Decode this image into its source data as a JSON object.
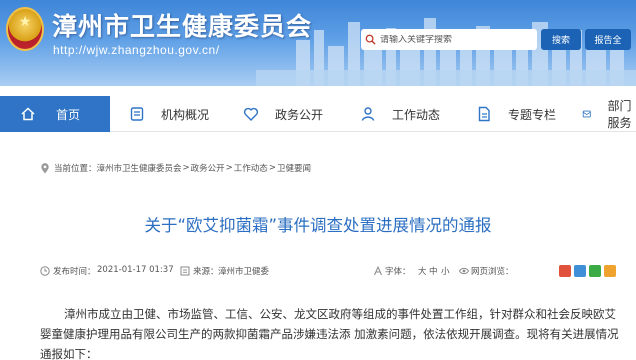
{
  "header": {
    "site_title": "漳州市卫生健康委员会",
    "site_url": "http://wjw.zhangzhou.gov.cn/",
    "search_placeholder": "请输入关键字搜索",
    "search_button": "搜索",
    "advanced_search_button": "报告全"
  },
  "nav": {
    "items": [
      {
        "label": "首页",
        "icon": "home-icon",
        "active": true
      },
      {
        "label": "机构概况",
        "icon": "org-icon",
        "active": false
      },
      {
        "label": "政务公开",
        "icon": "heart-icon",
        "active": false
      },
      {
        "label": "工作动态",
        "icon": "people-icon",
        "active": false
      },
      {
        "label": "专题专栏",
        "icon": "document-icon",
        "active": false
      },
      {
        "label": "部门服务",
        "icon": "service-icon",
        "active": false
      }
    ]
  },
  "breadcrumb": {
    "prefix": "当前位置：",
    "items": [
      "漳州市卫生健康委员会",
      "政务公开",
      "工作动态",
      "卫健要闻"
    ],
    "separator": ">"
  },
  "article": {
    "title": "关于“欧艾抑菌霜”事件调查处置进展情况的通报",
    "meta": {
      "publish_label": "发布时间：",
      "publish_time": "2021-01-17 01:37",
      "source_label": "来源：",
      "source": "漳州市卫健委",
      "font_label": "字体：",
      "font_large": "大",
      "font_medium": "中",
      "font_small": "小",
      "visits_label": "网页浏览："
    },
    "paragraph": "漳州市成立由卫健、市场监管、工信、公安、龙文区政府等组成的事件处置工作组，针对群众和社会反映欧艾婴童健康护理用品有限公司生产的两款抑菌霜产品涉嫌违法添 加激素问题，依法依规开展调查。现将有关进展情况通报如下："
  },
  "colors": {
    "nav_active": "#2f74c6",
    "title_blue": "#2c6fc2",
    "header_button": "#1c63b6"
  }
}
